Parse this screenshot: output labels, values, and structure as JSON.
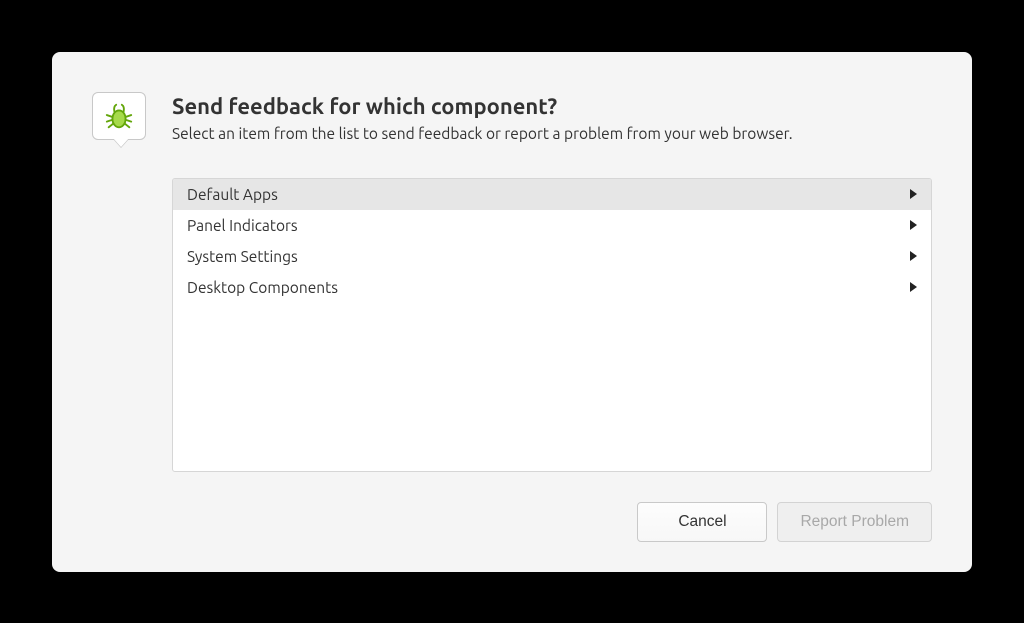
{
  "dialog": {
    "title": "Send feedback for which component?",
    "subtitle": "Select an item from the list to send feedback or report a problem from your web browser.",
    "icon": "bug-icon"
  },
  "component_list": [
    {
      "label": "Default Apps",
      "selected": true
    },
    {
      "label": "Panel Indicators",
      "selected": false
    },
    {
      "label": "System Settings",
      "selected": false
    },
    {
      "label": "Desktop Components",
      "selected": false
    }
  ],
  "buttons": {
    "cancel": "Cancel",
    "report": "Report Problem",
    "report_enabled": false
  }
}
